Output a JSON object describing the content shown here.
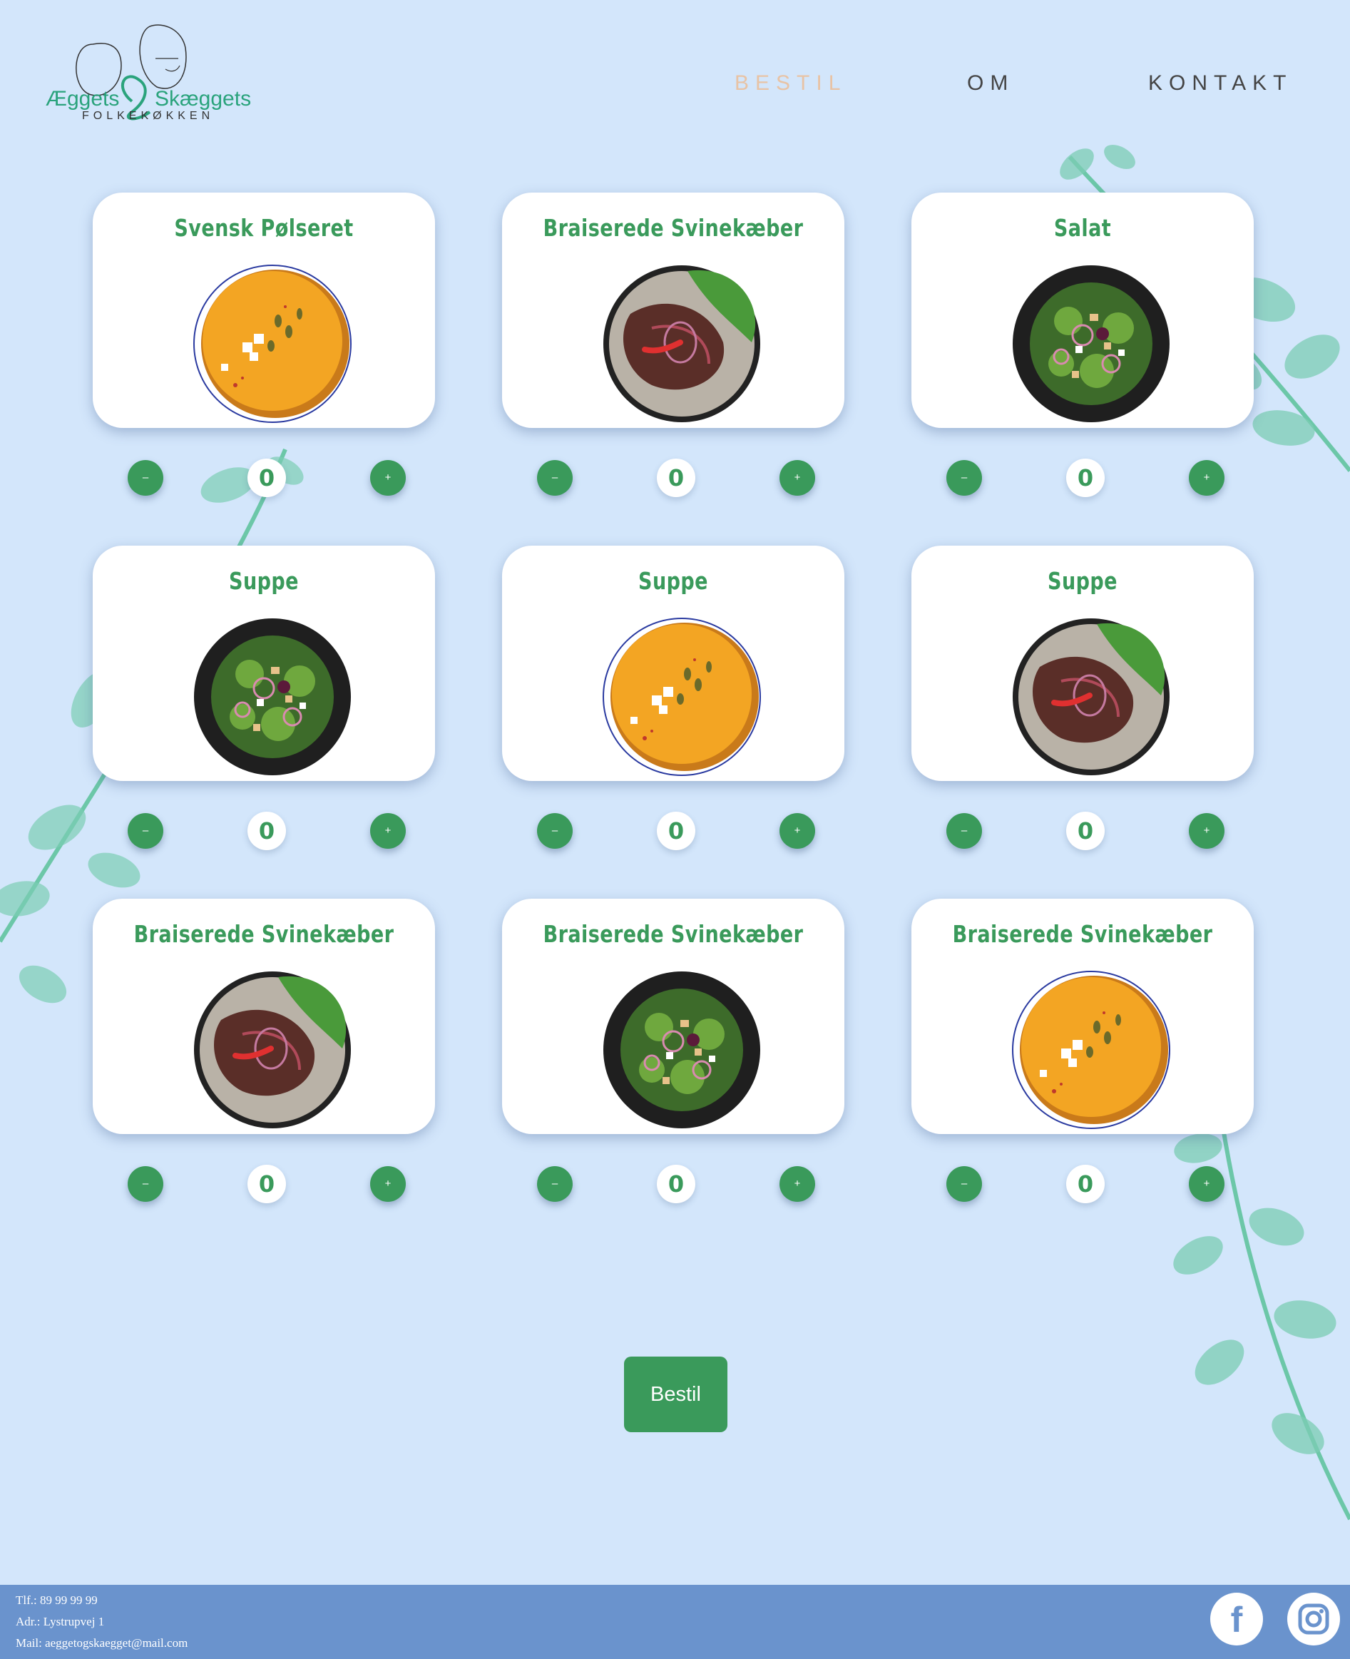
{
  "header": {
    "logo_left": "Æggets",
    "logo_right": "Skæggets",
    "logo_sub": "FOLKEKØKKEN",
    "nav": [
      {
        "label": "BESTIL",
        "active": true
      },
      {
        "label": "OM",
        "active": false
      },
      {
        "label": "KONTAKT",
        "active": false
      }
    ]
  },
  "menu": {
    "items": [
      {
        "title": "Svensk Pølseret",
        "dish": "soup-bowl",
        "qty": "0",
        "minus": "–",
        "plus": "+"
      },
      {
        "title": "Braiserede Svinekæber",
        "dish": "steak-plate",
        "qty": "0",
        "minus": "–",
        "plus": "+"
      },
      {
        "title": "Salat",
        "dish": "salad-plate",
        "qty": "0",
        "minus": "–",
        "plus": "+"
      },
      {
        "title": "Suppe",
        "dish": "salad-plate",
        "qty": "0",
        "minus": "–",
        "plus": "+"
      },
      {
        "title": "Suppe",
        "dish": "soup-bowl",
        "qty": "0",
        "minus": "–",
        "plus": "+"
      },
      {
        "title": "Suppe",
        "dish": "steak-plate",
        "qty": "0",
        "minus": "–",
        "plus": "+"
      },
      {
        "title": "Braiserede Svinekæber",
        "dish": "steak-plate",
        "qty": "0",
        "minus": "–",
        "plus": "+"
      },
      {
        "title": "Braiserede Svinekæber",
        "dish": "salad-plate",
        "qty": "0",
        "minus": "–",
        "plus": "+"
      },
      {
        "title": "Braiserede Svinekæber",
        "dish": "soup-bowl",
        "qty": "0",
        "minus": "–",
        "plus": "+"
      }
    ]
  },
  "order_button": "Bestil",
  "footer": {
    "phone": "Tlf.: 89 99 99 99",
    "address": "Adr.: Lystrupvej 1",
    "mail": "Mail: aeggetogskaegget@mail.com",
    "social": [
      "facebook-icon",
      "instagram-icon"
    ]
  },
  "colors": {
    "background": "#d3e6fb",
    "accent_green": "#3a9a5b",
    "active_nav": "#e8c3a5",
    "footer": "#6a93cd"
  }
}
